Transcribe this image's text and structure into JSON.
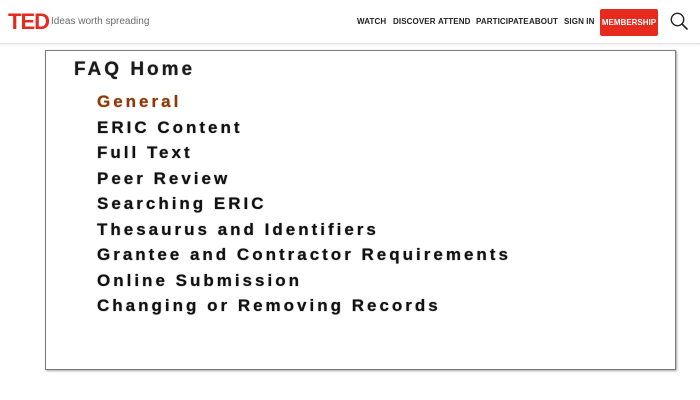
{
  "header": {
    "logo": "TED",
    "tagline": "Ideas worth spreading",
    "nav": [
      "WATCH",
      "DISCOVER",
      "ATTEND",
      "PARTICIPATE",
      "ABOUT",
      "SIGN IN"
    ],
    "membership_label": "MEMBERSHIP",
    "search_icon": "search-icon"
  },
  "faq": {
    "title": "FAQ Home",
    "items": [
      "General",
      "ERIC Content",
      "Full Text",
      "Peer Review",
      "Searching ERIC",
      "Thesaurus and Identifiers",
      "Grantee and Contractor Requirements",
      "Online Submission",
      "Changing or Removing Records"
    ]
  },
  "colors": {
    "brand": "#e62b1e",
    "active_item": "#8a3a10"
  }
}
